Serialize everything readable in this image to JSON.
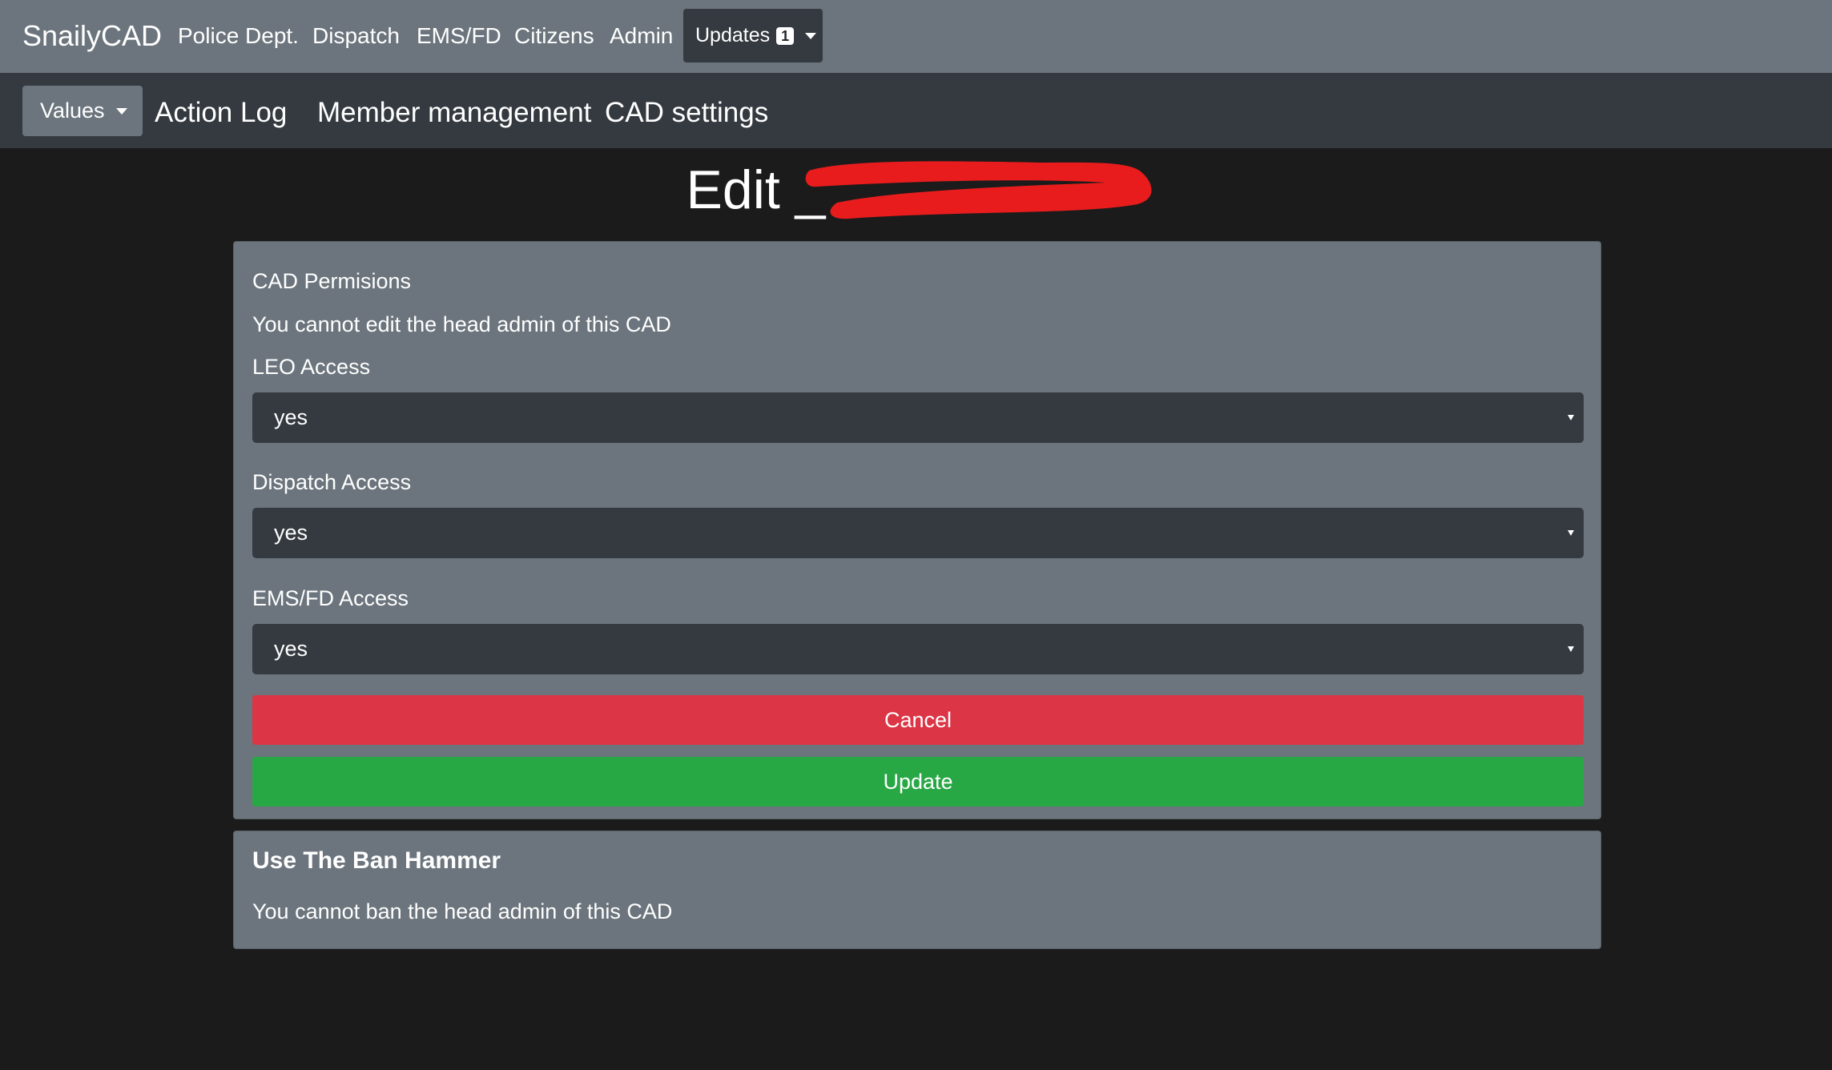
{
  "topnav": {
    "brand": "SnailyCAD",
    "links": [
      "Police Dept.",
      "Dispatch",
      "EMS/FD",
      "Citizens",
      "Admin"
    ],
    "updates_label": "Updates",
    "updates_badge": "1"
  },
  "subnav": {
    "values_label": "Values",
    "links": [
      "Action Log",
      "Member management",
      "CAD settings"
    ]
  },
  "page": {
    "title": "Edit _",
    "redaction_color": "#e81c1c"
  },
  "permissions": {
    "heading": "CAD Permisions",
    "notice": "You cannot edit the head admin of this CAD",
    "fields": [
      {
        "label": "LEO Access",
        "value": "yes"
      },
      {
        "label": "Dispatch Access",
        "value": "yes"
      },
      {
        "label": "EMS/FD Access",
        "value": "yes"
      }
    ],
    "cancel_label": "Cancel",
    "update_label": "Update"
  },
  "ban": {
    "heading": "Use The Ban Hammer",
    "notice": "You cannot ban the head admin of this CAD"
  },
  "colors": {
    "nav_bg": "#6c757d",
    "subnav_bg": "#343a40",
    "page_bg": "#1b1b1b",
    "cancel": "#dc3545",
    "update": "#28a745"
  }
}
